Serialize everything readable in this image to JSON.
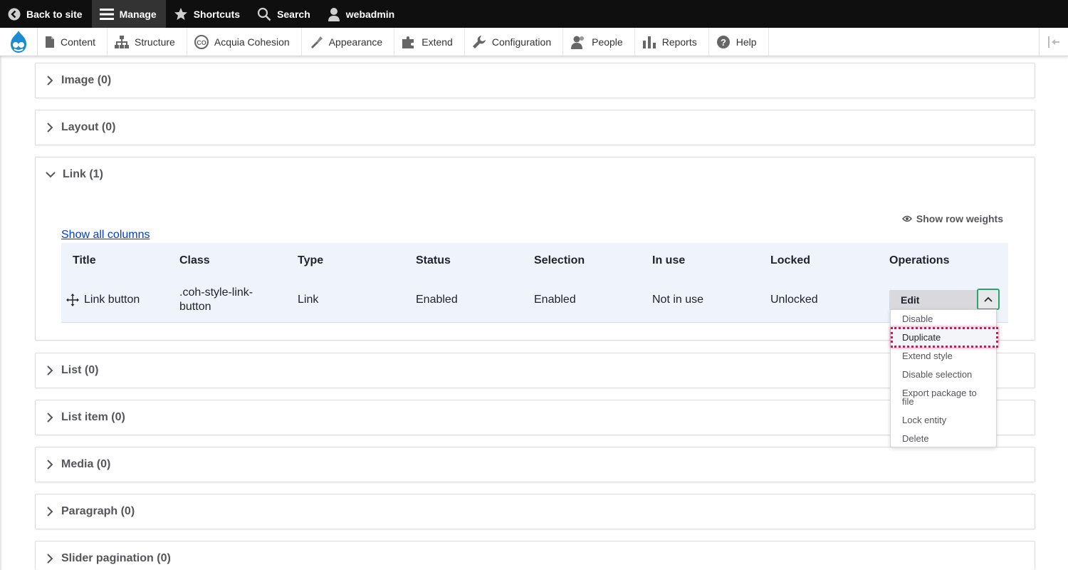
{
  "toolbar": {
    "back_to_site": "Back to site",
    "manage": "Manage",
    "shortcuts": "Shortcuts",
    "search": "Search",
    "user": "webadmin"
  },
  "tray": {
    "items": [
      "Content",
      "Structure",
      "Acquia Cohesion",
      "Appearance",
      "Extend",
      "Configuration",
      "People",
      "Reports",
      "Help"
    ]
  },
  "sections": {
    "image": "Image (0)",
    "layout": "Layout (0)",
    "link": "Link (1)",
    "list": "List (0)",
    "list_item": "List item (0)",
    "media": "Media (0)",
    "paragraph": "Paragraph (0)",
    "slider_pagination": "Slider pagination (0)"
  },
  "link_table": {
    "show_row_weights": "Show row weights",
    "show_all_columns": "Show all columns",
    "headers": [
      "Title",
      "Class",
      "Type",
      "Status",
      "Selection",
      "In use",
      "Locked",
      "Operations"
    ],
    "row": {
      "title": "Link button",
      "class": ".coh-style-link-button",
      "type": "Link",
      "status": "Enabled",
      "selection": "Enabled",
      "in_use": "Not in use",
      "locked": "Unlocked",
      "edit": "Edit"
    }
  },
  "operations_menu": {
    "items": [
      "Disable",
      "Duplicate",
      "Extend style",
      "Disable selection",
      "Export package to file",
      "Lock entity",
      "Delete"
    ]
  },
  "colors": {
    "topbar": "#0f0f0f",
    "link": "#003ecc",
    "focus_green": "#26a769",
    "highlight_pink": "#d4145a"
  }
}
